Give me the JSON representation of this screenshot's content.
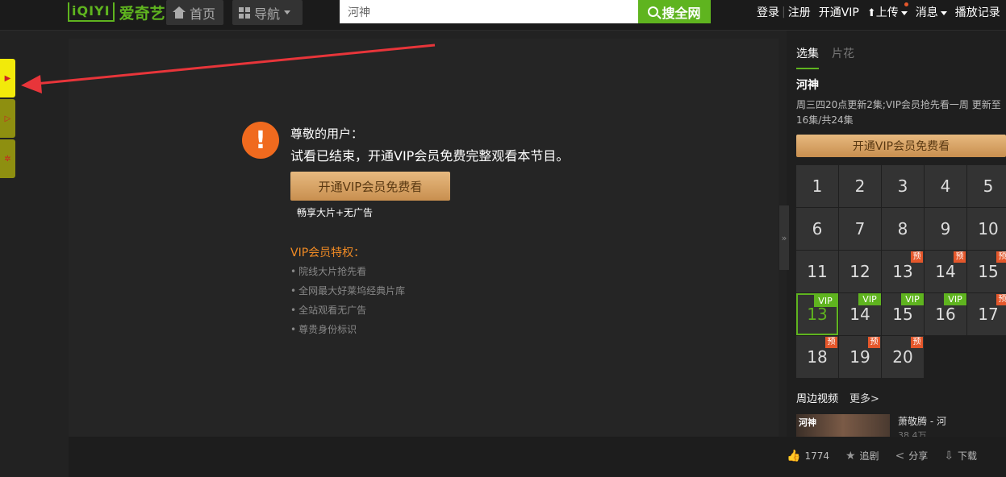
{
  "header": {
    "logo_badge": "iQIYI",
    "logo_text": "爱奇艺",
    "home_label": "首页",
    "guide_label": "导航",
    "search_value": "河神",
    "search_button": "搜全网",
    "login": "登录",
    "sep": "|",
    "register": "注册",
    "open_vip": "开通VIP",
    "upload": "上传",
    "messages": "消息",
    "history": "播放记录"
  },
  "sidebar_tabs": [
    "▶",
    "▷",
    "✲"
  ],
  "player": {
    "notice_title": "尊敬的用户：",
    "notice_text": "试看已结束，开通VIP会员免费完整观看本节目。",
    "vip_button": "开通VIP会员免费看",
    "vip_sub": "畅享大片+无广告",
    "privileges_title": "VIP会员特权：",
    "privileges": [
      "院线大片抢先看",
      "全网最大好莱坞经典片库",
      "全站观看无广告",
      "尊贵身份标识"
    ]
  },
  "panel": {
    "tab_selected": "选集",
    "tab_other": "片花",
    "show_title": "河神",
    "show_desc": "周三四20点更新2集;VIP会员抢先看一周 更新至16集/共24集",
    "vip_button": "开通VIP会员免费看",
    "collapse_glyph": "»",
    "episodes": [
      {
        "n": "1",
        "badge": ""
      },
      {
        "n": "2",
        "badge": ""
      },
      {
        "n": "3",
        "badge": ""
      },
      {
        "n": "4",
        "badge": ""
      },
      {
        "n": "5",
        "badge": ""
      },
      {
        "n": "6",
        "badge": ""
      },
      {
        "n": "7",
        "badge": ""
      },
      {
        "n": "8",
        "badge": ""
      },
      {
        "n": "9",
        "badge": ""
      },
      {
        "n": "10",
        "badge": ""
      },
      {
        "n": "11",
        "badge": ""
      },
      {
        "n": "12",
        "badge": ""
      },
      {
        "n": "13",
        "badge": "预"
      },
      {
        "n": "14",
        "badge": "预"
      },
      {
        "n": "15",
        "badge": "预"
      },
      {
        "n": "13",
        "badge": "VIP",
        "selected": true
      },
      {
        "n": "14",
        "badge": "VIP"
      },
      {
        "n": "15",
        "badge": "VIP"
      },
      {
        "n": "16",
        "badge": "VIP"
      },
      {
        "n": "17",
        "badge": "预"
      },
      {
        "n": "18",
        "badge": "预"
      },
      {
        "n": "19",
        "badge": "预"
      },
      {
        "n": "20",
        "badge": "预"
      }
    ],
    "related_title": "周边视频",
    "related_more": "更多>",
    "related_item_thumb_text": "河神",
    "related_item_title": "萧敬腾 - 河",
    "related_item_views": "38.4万"
  },
  "actions": {
    "likes": "1774",
    "like_icon": "👍",
    "follow": "追剧",
    "follow_icon": "★",
    "share": "分享",
    "share_icon": "<",
    "download": "下载",
    "download_icon": "⇩"
  },
  "colors": {
    "brand_green": "#5fb41f",
    "warning_orange": "#f06a1e",
    "vip_gold": "#d9a466",
    "annotation_red": "#e8353a"
  }
}
